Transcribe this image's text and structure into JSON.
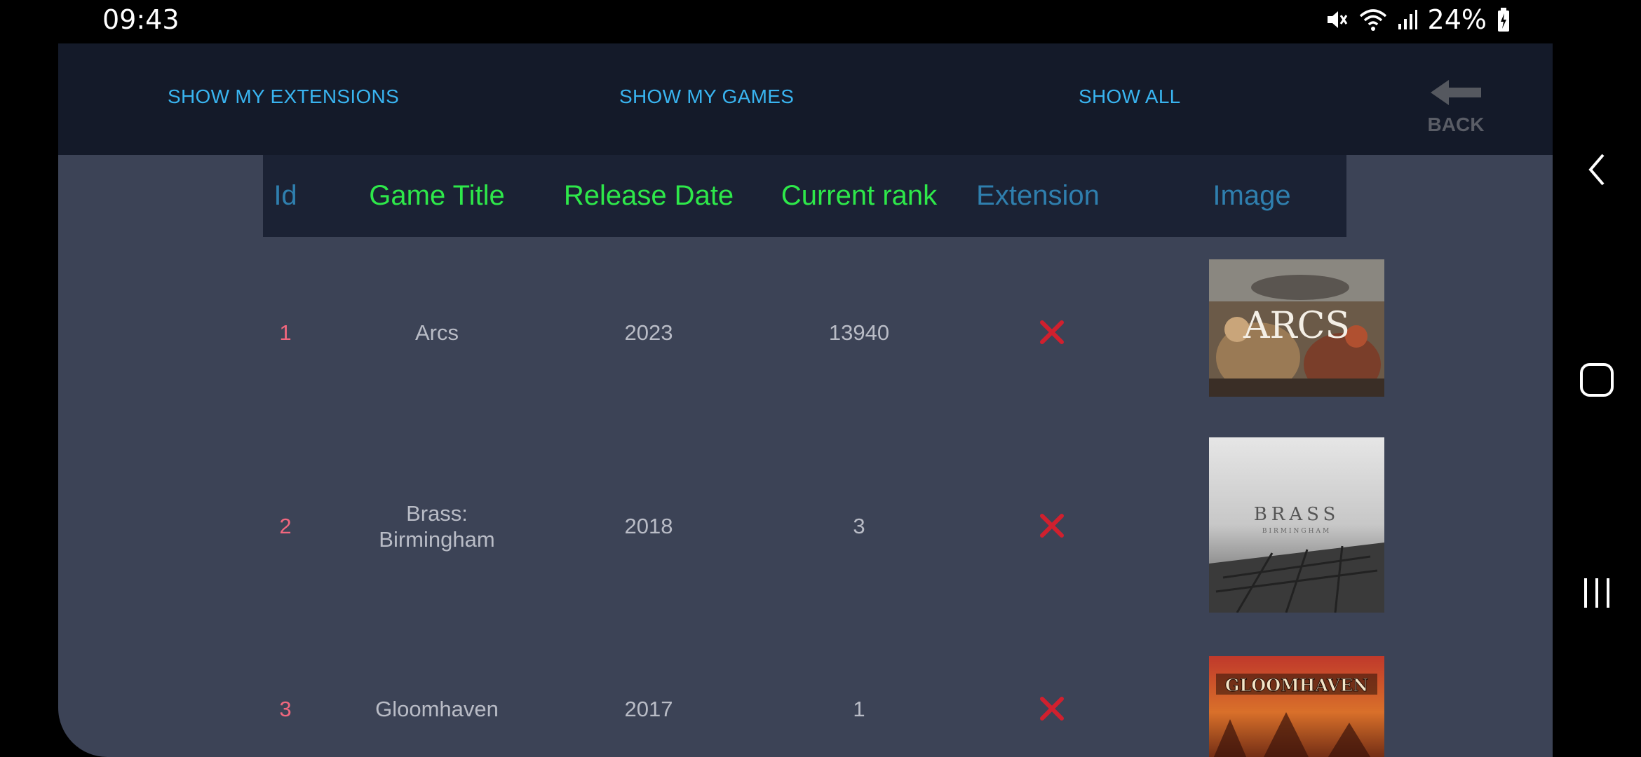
{
  "status_bar": {
    "time": "09:43",
    "battery": "24%",
    "icons": [
      "mute-icon",
      "wifi-icon",
      "signal-icon",
      "battery-charging-icon"
    ]
  },
  "toolbar": {
    "show_extensions": "SHOW MY EXTENSIONS",
    "show_games": "SHOW MY GAMES",
    "show_all": "SHOW ALL",
    "back": "BACK"
  },
  "table": {
    "headers": {
      "id": "Id",
      "title": "Game Title",
      "release": "Release Date",
      "rank": "Current rank",
      "extension": "Extension",
      "image": "Image"
    },
    "rows": [
      {
        "id": "1",
        "title": "Arcs",
        "release": "2023",
        "rank": "13940",
        "extension": false,
        "cover_title": "ARCS"
      },
      {
        "id": "2",
        "title": "Brass: Birmingham",
        "release": "2018",
        "rank": "3",
        "extension": false,
        "cover_title": "BRASS",
        "cover_subtitle": "BIRMINGHAM"
      },
      {
        "id": "3",
        "title": "Gloomhaven",
        "release": "2017",
        "rank": "1",
        "extension": false,
        "cover_title": "GLOOMHAVEN"
      }
    ]
  },
  "colors": {
    "accent_link": "#39b4f0",
    "header_green": "#2ee84a",
    "header_blue": "#2f7fae",
    "id_pink": "#f2677e",
    "cross_red": "#d0202e"
  }
}
